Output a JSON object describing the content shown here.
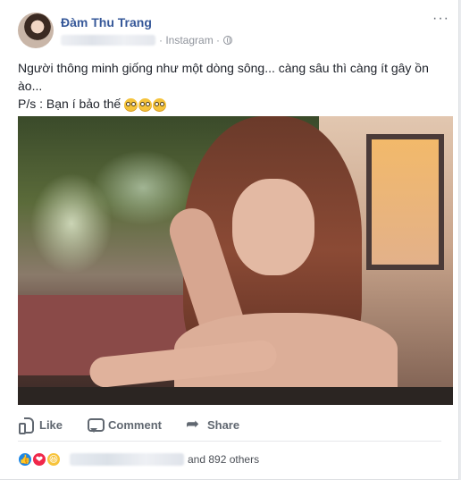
{
  "post": {
    "author": "Đàm Thu Trang",
    "source": "· Instagram ·",
    "body_line1": "Người thông minh giống như một dòng sông... càng sâu thì càng ít gây ồn",
    "body_line2": "ào...",
    "body_line3_prefix": "P/s : Bạn í bảo thế",
    "more_label": "···"
  },
  "actions": {
    "like": "Like",
    "comment": "Comment",
    "share": "Share"
  },
  "reactions": {
    "summary_suffix": "and 892 others"
  }
}
